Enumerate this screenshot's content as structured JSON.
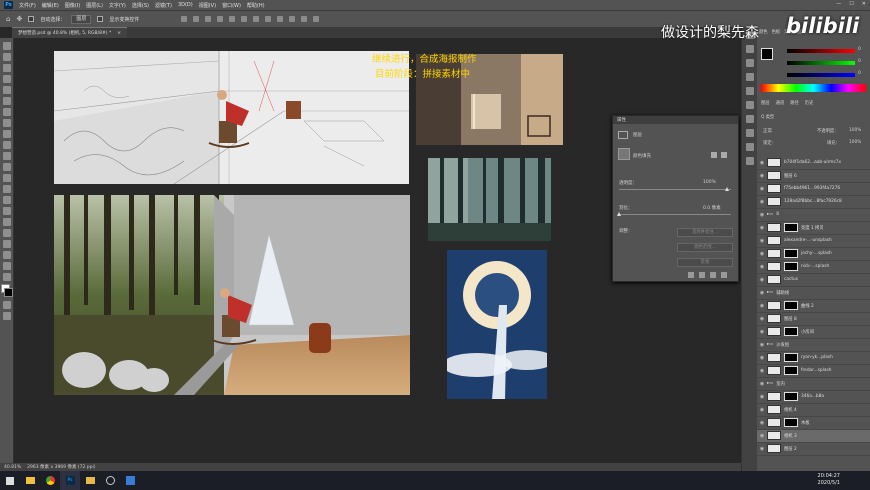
{
  "app": {
    "menu": [
      "文件(F)",
      "编辑(E)",
      "图像(I)",
      "图层(L)",
      "文字(Y)",
      "选择(S)",
      "滤镜(T)",
      "3D(D)",
      "视图(V)",
      "窗口(W)",
      "帮助(H)"
    ],
    "window_controls": [
      "—",
      "☐",
      "✕"
    ]
  },
  "options_bar": {
    "auto_select_label": "自动选择：",
    "auto_select_value": "图层",
    "show_transform_label": "显示变换控件"
  },
  "document_tab": {
    "title": "梦想营造.psd @ 40.8% (相机, 5, RGB/8#) *",
    "close": "×"
  },
  "annotations": {
    "line1": "继续进行，合成海报制作",
    "line2": "目前阶段：拼接素材中"
  },
  "watermark": {
    "text": "做设计的梨先森",
    "logo": "bilibili"
  },
  "statusbar": {
    "zoom": "40.81%",
    "doc_info": "2963 像素 x 3969 像素 (72 ppi)"
  },
  "taskbar": {
    "time": "20:04:27",
    "date": "2020/5/1"
  },
  "properties_panel": {
    "title": "属性",
    "section_label": "图层",
    "adj_label": "颜色填充",
    "opacity_label": "透明度：",
    "opacity_value": "100%",
    "feather_label": "羽化：",
    "feather_value": "0.0 像素",
    "refine_label": "调整：",
    "btn_select_mask": "选择并遮住...",
    "btn_color_range": "颜色范围...",
    "btn_invert": "反相"
  },
  "color_panel": {
    "tabs": [
      "颜色",
      "色板",
      "渐变",
      "图案"
    ],
    "r_value": "0",
    "g_value": "0",
    "b_value": "0"
  },
  "layers_panel": {
    "tabs": [
      "图层",
      "通道",
      "路径",
      "历史"
    ],
    "filter_label": "Q 类型",
    "blend_mode": "正常",
    "opacity_label": "不透明度：",
    "opacity_value": "100%",
    "lock_label": "锁定：",
    "fill_label": "填充：",
    "fill_value": "100%",
    "layers": [
      {
        "name": "b704f1da62...aab-ulrmc7x",
        "kind": "thumb"
      },
      {
        "name": "图层 6",
        "kind": "thumb"
      },
      {
        "name": "f75ebb4961...993f4a7276",
        "kind": "thumb"
      },
      {
        "name": "128ad2f8bbc...8fac7926c8",
        "kind": "thumb"
      },
      {
        "name": "8",
        "kind": "group"
      },
      {
        "name": "亮度 1 拷贝",
        "kind": "mask"
      },
      {
        "name": "alexandre-...-unsplash",
        "kind": "thumb"
      },
      {
        "name": "jochy-...splash",
        "kind": "mask"
      },
      {
        "name": "nick-...splash",
        "kind": "mask"
      },
      {
        "name": "cactus",
        "kind": "thumb"
      },
      {
        "name": "辅助线",
        "kind": "group"
      },
      {
        "name": "曲线 2",
        "kind": "mask"
      },
      {
        "name": "图层 8",
        "kind": "thumb"
      },
      {
        "name": "小房间",
        "kind": "mask"
      },
      {
        "name": "沙发组",
        "kind": "group"
      },
      {
        "name": "ryan-yk...plash",
        "kind": "mask"
      },
      {
        "name": "fredar...splash",
        "kind": "mask"
      },
      {
        "name": "室内",
        "kind": "group"
      },
      {
        "name": "346a...b8a",
        "kind": "mask"
      },
      {
        "name": "相机 4",
        "kind": "thumb"
      },
      {
        "name": "木板",
        "kind": "mask"
      },
      {
        "name": "相机 3",
        "kind": "thumb"
      },
      {
        "name": "图层 2",
        "kind": "thumb"
      }
    ]
  },
  "colors": {
    "accent": "#31a8ff",
    "annotation": "#ffd600",
    "panel": "#535353"
  }
}
